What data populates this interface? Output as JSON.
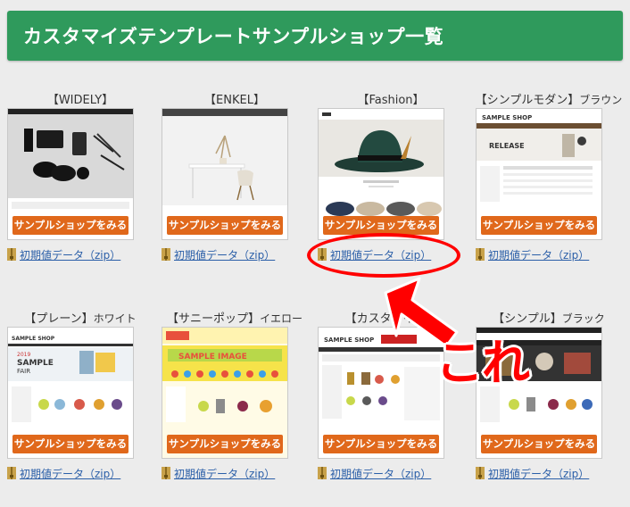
{
  "header": {
    "title": "カスタマイズテンプレートサンプルショップ一覧"
  },
  "cards": [
    {
      "title": "【WIDELY】",
      "subtitle": "",
      "button": "サンプルショップをみる",
      "download": "初期値データ（zip）"
    },
    {
      "title": "【ENKEL】",
      "subtitle": "",
      "button": "サンプルショップをみる",
      "download": "初期値データ（zip）"
    },
    {
      "title": "【Fashion】",
      "subtitle": "",
      "button": "サンプルショップをみる",
      "download": "初期値データ（zip）"
    },
    {
      "title": "【シンプルモダン】",
      "subtitle": "ブラウン",
      "button": "サンプルショップをみる",
      "download": "初期値データ（zip）"
    },
    {
      "title": "【プレーン】",
      "subtitle": "ホワイト",
      "button": "サンプルショップをみる",
      "download": "初期値データ（zip）"
    },
    {
      "title": "【サニーポップ】",
      "subtitle": "イエロー",
      "button": "サンプルショップをみる",
      "download": "初期値データ（zip）"
    },
    {
      "title": "【カスタマイズ",
      "subtitle": "ト",
      "button": "サンプルショップをみる",
      "download": "初期値データ（zip）"
    },
    {
      "title": "【シンプル】",
      "subtitle": "ブラック",
      "button": "サンプルショップをみる",
      "download": "初期値データ（zip）"
    }
  ],
  "thumb_text": {
    "sample_shop": "SAMPLE SHOP",
    "release": "RELEASE",
    "sample_image": "SAMPLE IMAGE",
    "sample_fair": "SAMPLE",
    "year": "2019",
    "fair": "FAIR"
  },
  "annotation": {
    "label": "これ"
  },
  "colors": {
    "header": "#2f9a5c",
    "button": "#e0681b",
    "link": "#2b5fa8",
    "annotation": "#ff0000"
  }
}
